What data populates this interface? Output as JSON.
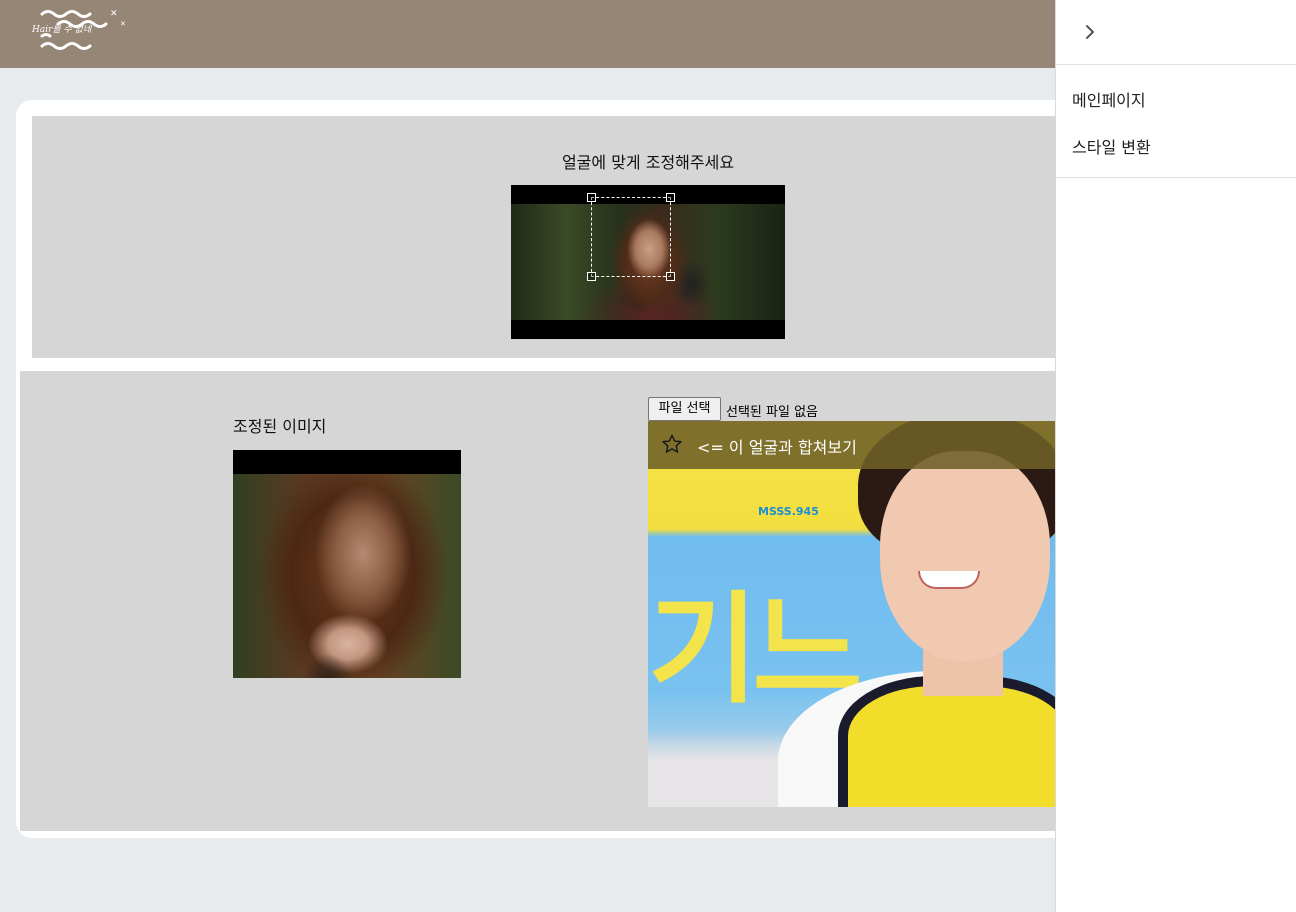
{
  "header": {
    "logo_text": "Hair를 수 없네",
    "background": "#968675"
  },
  "crop_section": {
    "title": "얼굴에 맞게 조정해주세요"
  },
  "result_section": {
    "title": "조정된 이미지"
  },
  "file_input": {
    "button_label": "파일 선택",
    "status": "선택된 파일 없음"
  },
  "photo_card": {
    "overlay_text": "<= 이 얼굴과 합쳐보기",
    "icon": "star-icon",
    "sign_text": "기느",
    "tag_text": "MSSS.945"
  },
  "drawer": {
    "toggle_icon": "chevron-right-icon",
    "items": [
      {
        "label": "메인페이지"
      },
      {
        "label": "스타일 변환"
      }
    ]
  }
}
